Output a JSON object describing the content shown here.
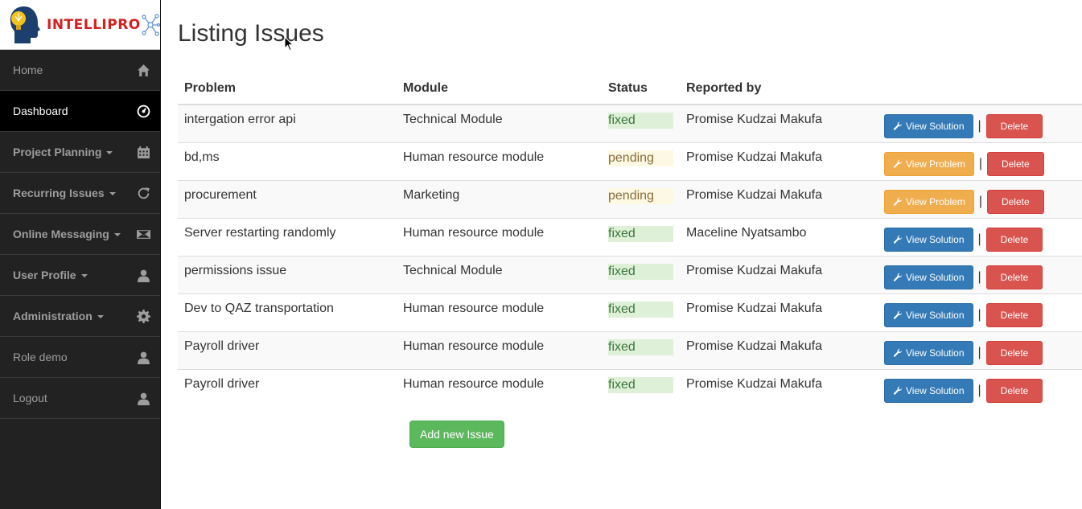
{
  "brand": {
    "name": "INTELLIPRO"
  },
  "sidebar": {
    "items": [
      {
        "label": "Home",
        "icon": "home-icon",
        "bold": false,
        "caret": false,
        "active": false
      },
      {
        "label": "Dashboard",
        "icon": "dashboard-icon",
        "bold": false,
        "caret": false,
        "active": true
      },
      {
        "label": "Project Planning",
        "icon": "calendar-icon",
        "bold": true,
        "caret": true,
        "active": false
      },
      {
        "label": "Recurring Issues",
        "icon": "refresh-icon",
        "bold": true,
        "caret": true,
        "active": false
      },
      {
        "label": "Online Messaging",
        "icon": "envelope-icon",
        "bold": true,
        "caret": true,
        "active": false
      },
      {
        "label": "User Profile",
        "icon": "user-icon",
        "bold": true,
        "caret": true,
        "active": false
      },
      {
        "label": "Administration",
        "icon": "cog-icon",
        "bold": true,
        "caret": true,
        "active": false
      },
      {
        "label": "Role demo",
        "icon": "user-icon",
        "bold": false,
        "caret": false,
        "active": false
      },
      {
        "label": "Logout",
        "icon": "user-icon",
        "bold": false,
        "caret": false,
        "active": false
      }
    ]
  },
  "page": {
    "title": "Listing Issues"
  },
  "table": {
    "headers": [
      "Problem",
      "Module",
      "Status",
      "Reported by",
      ""
    ],
    "rows": [
      {
        "problem": "intergation error api",
        "module": "Technical Module",
        "status": "fixed",
        "reporter": "Promise Kudzai Makufa",
        "action": "View Solution",
        "action_type": "primary",
        "delete": "Delete"
      },
      {
        "problem": "bd,ms",
        "module": "Human resource module",
        "status": "pending",
        "reporter": "Promise Kudzai Makufa",
        "action": "View Problem",
        "action_type": "warning",
        "delete": "Delete"
      },
      {
        "problem": "procurement",
        "module": "Marketing",
        "status": "pending",
        "reporter": "Promise Kudzai Makufa",
        "action": "View Problem",
        "action_type": "warning",
        "delete": "Delete"
      },
      {
        "problem": "Server restarting randomly",
        "module": "Human resource module",
        "status": "fixed",
        "reporter": "Maceline Nyatsambo",
        "action": "View Solution",
        "action_type": "primary",
        "delete": "Delete"
      },
      {
        "problem": "permissions issue",
        "module": "Technical Module",
        "status": "fixed",
        "reporter": "Promise Kudzai Makufa",
        "action": "View Solution",
        "action_type": "primary",
        "delete": "Delete"
      },
      {
        "problem": "Dev to QAZ transportation",
        "module": "Human resource module",
        "status": "fixed",
        "reporter": "Promise Kudzai Makufa",
        "action": "View Solution",
        "action_type": "primary",
        "delete": "Delete"
      },
      {
        "problem": "Payroll driver",
        "module": "Human resource module",
        "status": "fixed",
        "reporter": "Promise Kudzai Makufa",
        "action": "View Solution",
        "action_type": "primary",
        "delete": "Delete"
      },
      {
        "problem": "Payroll driver",
        "module": "Human resource module",
        "status": "fixed",
        "reporter": "Promise Kudzai Makufa",
        "action": "View Solution",
        "action_type": "primary",
        "delete": "Delete"
      }
    ],
    "separator": "|"
  },
  "add_button": {
    "label": "Add new Issue"
  },
  "colors": {
    "sidebar_bg": "#222222",
    "primary": "#337ab7",
    "warning": "#f0ad4e",
    "danger": "#d9534f",
    "success": "#5cb85c"
  }
}
